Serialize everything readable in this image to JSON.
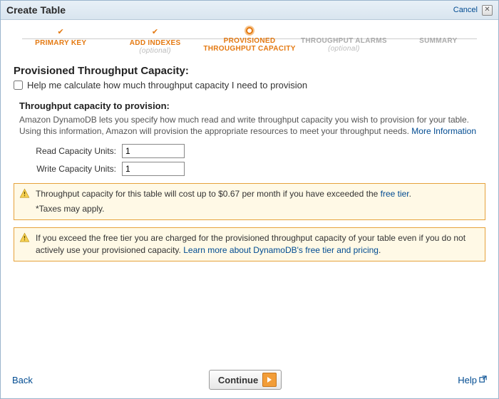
{
  "dialog": {
    "title": "Create Table",
    "cancel": "Cancel"
  },
  "stepper": {
    "step1": {
      "label": "PRIMARY KEY"
    },
    "step2": {
      "label": "ADD INDEXES",
      "sub": "(optional)"
    },
    "step3": {
      "label": "PROVISIONED THROUGHPUT CAPACITY"
    },
    "step4": {
      "label": "THROUGHPUT ALARMS",
      "sub": "(optional)"
    },
    "step5": {
      "label": "SUMMARY"
    }
  },
  "heading": "Provisioned Throughput Capacity:",
  "help_calc_label": "Help me calculate how much throughput capacity I need to provision",
  "section_title": "Throughput capacity to provision:",
  "desc_text": "Amazon DynamoDB lets you specify how much read and write throughput capacity you wish to provision for your table. Using this information, Amazon will provision the appropriate resources to meet your throughput needs. ",
  "more_info": "More Information",
  "read_label": "Read Capacity Units:",
  "write_label": "Write Capacity Units:",
  "read_value": "1",
  "write_value": "1",
  "alert1_pre": "Throughput capacity for this table will cost up to $0.67 per month if you have exceeded the ",
  "alert1_link": "free tier",
  "alert1_post": ".",
  "alert1_tax": "*Taxes may apply.",
  "alert2_pre": "If you exceed the free tier you are charged for the provisioned throughput capacity of your table even if you do not actively use your provisioned capacity. ",
  "alert2_link": "Learn more about DynamoDB's free tier and pricing",
  "alert2_post": ".",
  "footer": {
    "back": "Back",
    "continue": "Continue",
    "help": "Help"
  }
}
